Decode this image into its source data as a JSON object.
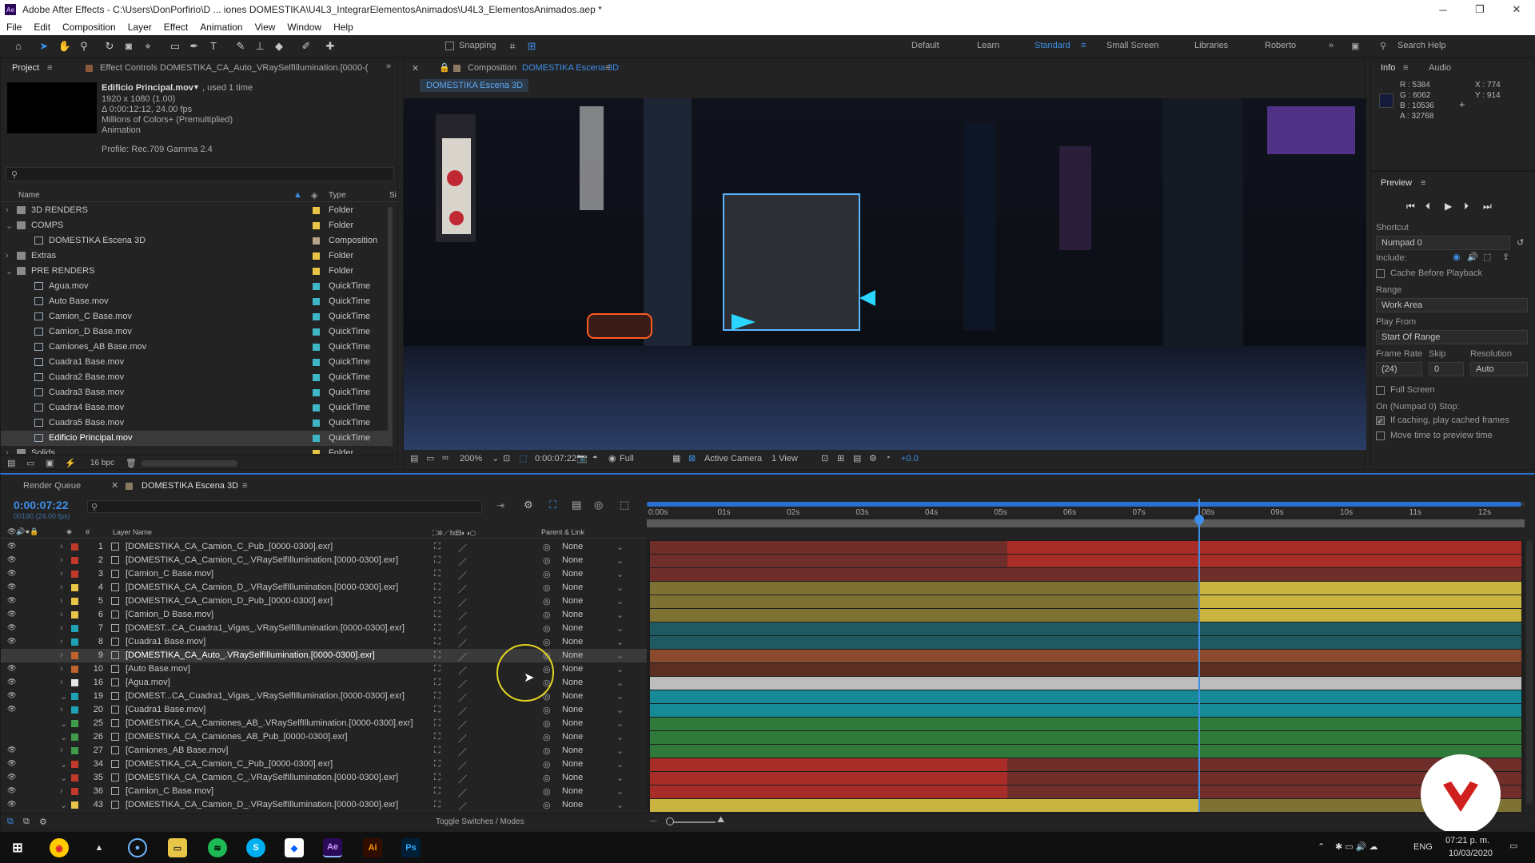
{
  "title_bar": {
    "title": "Adobe After Effects - C:\\Users\\DonPorfirio\\D ... iones DOMESTIKA\\U4L3_IntegrarElementosAnimados\\U4L3_ElementosAnimados.aep *",
    "minimize": "─",
    "maximize": "❐",
    "close": "✕"
  },
  "menu": [
    "File",
    "Edit",
    "Composition",
    "Layer",
    "Effect",
    "Animation",
    "View",
    "Window",
    "Help"
  ],
  "toolbar": {
    "snapping_label": "Snapping",
    "workspaces": [
      "Default",
      "Learn",
      "Standard",
      "Small Screen",
      "Libraries",
      "Roberto"
    ],
    "active_workspace": "Standard",
    "search_placeholder": "Search Help",
    "more": "»"
  },
  "project_panel": {
    "tab_project": "Project",
    "tab_effect_controls": "Effect Controls DOMESTIKA_CA_Auto_VRaySelfIllumination.[0000-(",
    "file_name": "Edificio Principal.mov",
    "used": ", used 1 time",
    "info_lines": [
      "1920 x 1080 (1.00)",
      "Δ 0:00:12:12, 24.00 fps",
      "Millions of Colors+ (Premultiplied)",
      "Animation"
    ],
    "profile": "Profile: Rec.709 Gamma 2.4",
    "col_name": "Name",
    "col_type": "Type",
    "col_size": "Si",
    "items": [
      {
        "name": "3D RENDERS",
        "type": "Folder",
        "color": "#e8c547",
        "kind": "folder",
        "indent": 0,
        "arrow": "›"
      },
      {
        "name": "COMPS",
        "type": "Folder",
        "color": "#e8c547",
        "kind": "folder",
        "indent": 0,
        "arrow": "⌄"
      },
      {
        "name": "DOMESTIKA Escena 3D",
        "type": "Composition",
        "color": "#b9a48a",
        "kind": "comp",
        "indent": 1,
        "arrow": ""
      },
      {
        "name": "Extras",
        "type": "Folder",
        "color": "#e8c547",
        "kind": "folder",
        "indent": 0,
        "arrow": "›"
      },
      {
        "name": "PRE RENDERS",
        "type": "Folder",
        "color": "#e8c547",
        "kind": "folder",
        "indent": 0,
        "arrow": "⌄"
      },
      {
        "name": "Agua.mov",
        "type": "QuickTime",
        "color": "#3fb6c6",
        "kind": "file",
        "indent": 1,
        "arrow": ""
      },
      {
        "name": "Auto Base.mov",
        "type": "QuickTime",
        "color": "#3fb6c6",
        "kind": "file",
        "indent": 1,
        "arrow": ""
      },
      {
        "name": "Camion_C Base.mov",
        "type": "QuickTime",
        "color": "#3fb6c6",
        "kind": "file",
        "indent": 1,
        "arrow": ""
      },
      {
        "name": "Camion_D Base.mov",
        "type": "QuickTime",
        "color": "#3fb6c6",
        "kind": "file",
        "indent": 1,
        "arrow": ""
      },
      {
        "name": "Camiones_AB Base.mov",
        "type": "QuickTime",
        "color": "#3fb6c6",
        "kind": "file",
        "indent": 1,
        "arrow": ""
      },
      {
        "name": "Cuadra1 Base.mov",
        "type": "QuickTime",
        "color": "#3fb6c6",
        "kind": "file",
        "indent": 1,
        "arrow": ""
      },
      {
        "name": "Cuadra2 Base.mov",
        "type": "QuickTime",
        "color": "#3fb6c6",
        "kind": "file",
        "indent": 1,
        "arrow": ""
      },
      {
        "name": "Cuadra3 Base.mov",
        "type": "QuickTime",
        "color": "#3fb6c6",
        "kind": "file",
        "indent": 1,
        "arrow": ""
      },
      {
        "name": "Cuadra4 Base.mov",
        "type": "QuickTime",
        "color": "#3fb6c6",
        "kind": "file",
        "indent": 1,
        "arrow": ""
      },
      {
        "name": "Cuadra5 Base.mov",
        "type": "QuickTime",
        "color": "#3fb6c6",
        "kind": "file",
        "indent": 1,
        "arrow": ""
      },
      {
        "name": "Edificio Principal.mov",
        "type": "QuickTime",
        "color": "#3fb6c6",
        "kind": "file",
        "indent": 1,
        "arrow": "",
        "selected": true
      },
      {
        "name": "Solids",
        "type": "Folder",
        "color": "#e8c547",
        "kind": "folder",
        "indent": 0,
        "arrow": "›"
      }
    ],
    "bpc": "16 bpc"
  },
  "composition": {
    "tab_label": "Composition",
    "comp_name": "DOMESTIKA Escena 3D",
    "flow_tab": "DOMESTIKA Escena 3D",
    "zoom": "200%",
    "timecode": "0:00:07:22",
    "resolution": "Full",
    "camera": "Active Camera",
    "view": "1 View",
    "exposure": "+0.0"
  },
  "info_panel": {
    "tab_info": "Info",
    "tab_audio": "Audio",
    "r": "R : 5384",
    "g": "G : 6062",
    "b": "B : 10536",
    "a": "A : 32768",
    "x": "X : 774",
    "y": "Y : 914"
  },
  "preview_panel": {
    "title": "Preview",
    "shortcut_label": "Shortcut",
    "shortcut_value": "Numpad 0",
    "include_label": "Include:",
    "cache_label": "Cache Before Playback",
    "range_label": "Range",
    "range_value": "Work Area",
    "play_from_label": "Play From",
    "play_from_value": "Start Of Range",
    "frame_rate_label": "Frame Rate",
    "skip_label": "Skip",
    "resolution_label": "Resolution",
    "frame_rate_value": "(24)",
    "skip_value": "0",
    "resolution_value": "Auto",
    "full_screen_label": "Full Screen",
    "stop_label": "On (Numpad 0) Stop:",
    "if_caching_label": "If caching, play cached frames",
    "move_time_label": "Move time to preview time"
  },
  "timeline": {
    "render_queue_tab": "Render Queue",
    "comp_tab": "DOMESTIKA Escena 3D",
    "timecode": "0:00:07:22",
    "frames": "00190 (24.00 fps)",
    "col_hash": "#",
    "col_layer_name": "Layer Name",
    "col_parent": "Parent & Link",
    "ruler": [
      "0:00s",
      "01s",
      "02s",
      "03s",
      "04s",
      "05s",
      "06s",
      "07s",
      "08s",
      "09s",
      "10s",
      "11s",
      "12s"
    ],
    "toggle_label": "Toggle Switches / Modes",
    "layers": [
      {
        "num": "1",
        "name": "[DOMESTIKA_CA_Camion_C_Pub_[0000-0300].exr]",
        "color": "#c0392b",
        "parent": "None",
        "arrow": "›",
        "bar": "#6f2e2a",
        "bar2": "#a82c27",
        "split": 0.41,
        "eye": true
      },
      {
        "num": "2",
        "name": "[DOMESTIKA_CA_Camion_C_.VRaySelfIllumination.[0000-0300].exr]",
        "color": "#c0392b",
        "parent": "None",
        "arrow": "›",
        "bar": "#6f2e2a",
        "bar2": "#a82c27",
        "split": 0.41,
        "eye": true
      },
      {
        "num": "3",
        "name": "[Camion_C Base.mov]",
        "color": "#c0392b",
        "parent": "None",
        "arrow": "›",
        "bar": "#6f2e2a",
        "bar2": "#6f2e2a",
        "split": 0,
        "eye": true
      },
      {
        "num": "4",
        "name": "[DOMESTIKA_CA_Camion_D_.VRaySelfIllumination.[0000-0300].exr]",
        "color": "#e8c547",
        "parent": "None",
        "arrow": "›",
        "bar": "#7d7134",
        "bar2": "#c9b43f",
        "split": 0.63,
        "eye": true
      },
      {
        "num": "5",
        "name": "[DOMESTIKA_CA_Camion_D_Pub_[0000-0300].exr]",
        "color": "#e8c547",
        "parent": "None",
        "arrow": "›",
        "bar": "#7d7134",
        "bar2": "#c9b43f",
        "split": 0.63,
        "eye": true
      },
      {
        "num": "6",
        "name": "[Camion_D Base.mov]",
        "color": "#e8c547",
        "parent": "None",
        "arrow": "›",
        "bar": "#7d7134",
        "bar2": "#c9b43f",
        "split": 0.63,
        "eye": true
      },
      {
        "num": "7",
        "name": "[DOMEST...CA_Cuadra1_Vigas_.VRaySelfIllumination.[0000-0300].exr]",
        "color": "#1fa2b3",
        "parent": "None",
        "arrow": "›",
        "bar": "#1f5a62",
        "bar2": "#1f5a62",
        "split": 0,
        "eye": true
      },
      {
        "num": "8",
        "name": "[Cuadra1 Base.mov]",
        "color": "#1fa2b3",
        "parent": "None",
        "arrow": "›",
        "bar": "#1f5a62",
        "bar2": "#1f5a62",
        "split": 0,
        "eye": true
      },
      {
        "num": "9",
        "name": "[DOMESTIKA_CA_Auto_.VRaySelfIllumination.[0000-0300].exr]",
        "color": "#c0622b",
        "parent": "None",
        "arrow": "›",
        "bar": "#8a4a2d",
        "bar2": "#8a4a2d",
        "split": 0,
        "eye": false,
        "selected": true
      },
      {
        "num": "10",
        "name": "[Auto Base.mov]",
        "color": "#c0622b",
        "parent": "None",
        "arrow": "›",
        "bar": "#5b2f22",
        "bar2": "#5b2f22",
        "split": 0,
        "eye": true
      },
      {
        "num": "16",
        "name": "[Agua.mov]",
        "color": "#e6e6e6",
        "parent": "None",
        "arrow": "›",
        "bar": "#bdbdbd",
        "bar2": "#bdbdbd",
        "split": 0,
        "eye": true
      },
      {
        "num": "19",
        "name": "[DOMEST...CA_Cuadra1_Vigas_.VRaySelfIllumination.[0000-0300].exr]",
        "color": "#1fa2b3",
        "parent": "None",
        "arrow": "⌄",
        "bar": "#168a96",
        "bar2": "#168a96",
        "split": 0,
        "eye": true
      },
      {
        "num": "20",
        "name": "[Cuadra1 Base.mov]",
        "color": "#1fa2b3",
        "parent": "None",
        "arrow": "›",
        "bar": "#168a96",
        "bar2": "#168a96",
        "split": 0,
        "eye": true
      },
      {
        "num": "25",
        "name": "[DOMESTIKA_CA_Camiones_AB_.VRaySelfIllumination.[0000-0300].exr]",
        "color": "#3e9c4b",
        "parent": "None",
        "arrow": "⌄",
        "bar": "#2f7a3a",
        "bar2": "#2f7a3a",
        "split": 0,
        "eye": false
      },
      {
        "num": "26",
        "name": "[DOMESTIKA_CA_Camiones_AB_Pub_[0000-0300].exr]",
        "color": "#3e9c4b",
        "parent": "None",
        "arrow": "⌄",
        "bar": "#2f7a3a",
        "bar2": "#2f7a3a",
        "split": 0,
        "eye": false
      },
      {
        "num": "27",
        "name": "[Camiones_AB Base.mov]",
        "color": "#3e9c4b",
        "parent": "None",
        "arrow": "›",
        "bar": "#2f7a3a",
        "bar2": "#2f7a3a",
        "split": 0,
        "eye": true
      },
      {
        "num": "34",
        "name": "[DOMESTIKA_CA_Camion_C_Pub_[0000-0300].exr]",
        "color": "#c0392b",
        "parent": "None",
        "arrow": "⌄",
        "bar": "#a82c27",
        "bar2": "#6f2e2a",
        "split": 0.41,
        "eye": true
      },
      {
        "num": "35",
        "name": "[DOMESTIKA_CA_Camion_C_.VRaySelfIllumination.[0000-0300].exr]",
        "color": "#c0392b",
        "parent": "None",
        "arrow": "⌄",
        "bar": "#a82c27",
        "bar2": "#6f2e2a",
        "split": 0.41,
        "eye": true
      },
      {
        "num": "36",
        "name": "[Camion_C Base.mov]",
        "color": "#c0392b",
        "parent": "None",
        "arrow": "›",
        "bar": "#a82c27",
        "bar2": "#6f2e2a",
        "split": 0.41,
        "eye": true
      },
      {
        "num": "43",
        "name": "[DOMESTIKA_CA_Camion_D_.VRaySelfIllumination.[0000-0300].exr]",
        "color": "#e8c547",
        "parent": "None",
        "arrow": "⌄",
        "bar": "#c9b43f",
        "bar2": "#7d7134",
        "split": 0.63,
        "eye": true
      }
    ]
  },
  "taskbar": {
    "time": "07:21 p. m.",
    "date": "10/03/2020",
    "lang": "ENG",
    "apps": [
      "Windows",
      "Chrome",
      "Photos",
      "Media",
      "Explorer",
      "Spotify",
      "Skype",
      "Dropbox",
      "Ae",
      "Ai",
      "Ps"
    ]
  }
}
